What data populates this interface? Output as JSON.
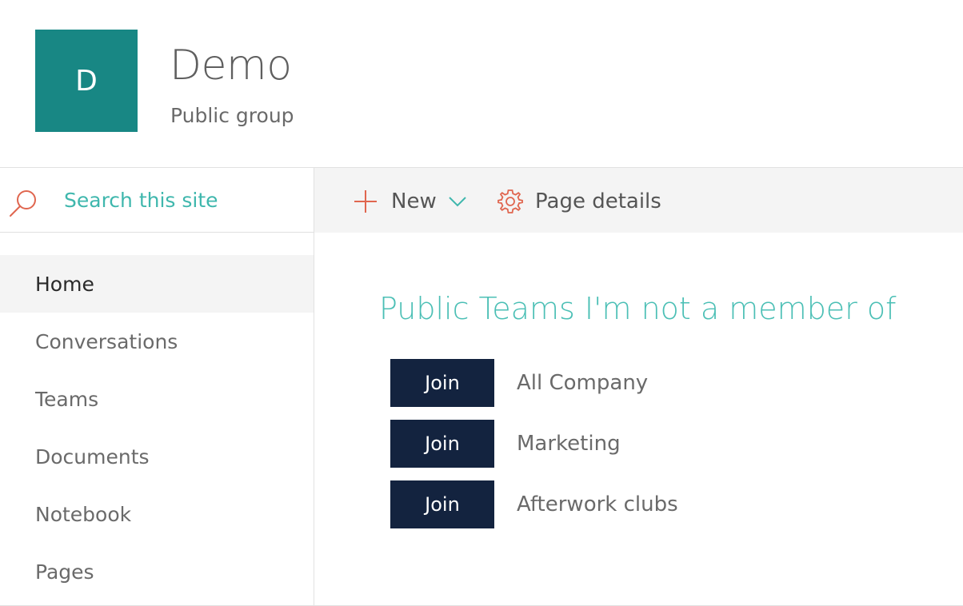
{
  "site": {
    "logo_letter": "D",
    "logo_color": "#188784",
    "title": "Demo",
    "subtitle": "Public group"
  },
  "search": {
    "placeholder": "Search this site",
    "icon": "search-icon"
  },
  "command_bar": {
    "new_label": "New",
    "new_icon": "plus-icon",
    "new_dropdown_icon": "chevron-down-icon",
    "page_details_label": "Page details",
    "page_details_icon": "gear-icon"
  },
  "nav": {
    "items": [
      {
        "label": "Home",
        "selected": true
      },
      {
        "label": "Conversations",
        "selected": false
      },
      {
        "label": "Teams",
        "selected": false
      },
      {
        "label": "Documents",
        "selected": false
      },
      {
        "label": "Notebook",
        "selected": false
      },
      {
        "label": "Pages",
        "selected": false
      }
    ]
  },
  "main": {
    "section_title": "Public Teams I'm not a member of",
    "teams": [
      {
        "button_label": "Join",
        "name": "All Company"
      },
      {
        "button_label": "Join",
        "name": "Marketing"
      },
      {
        "button_label": "Join",
        "name": "Afterwork clubs"
      }
    ]
  },
  "colors": {
    "accent": "#3fb7ad",
    "icon_accent": "#e0664f",
    "join_button": "#13233f"
  }
}
